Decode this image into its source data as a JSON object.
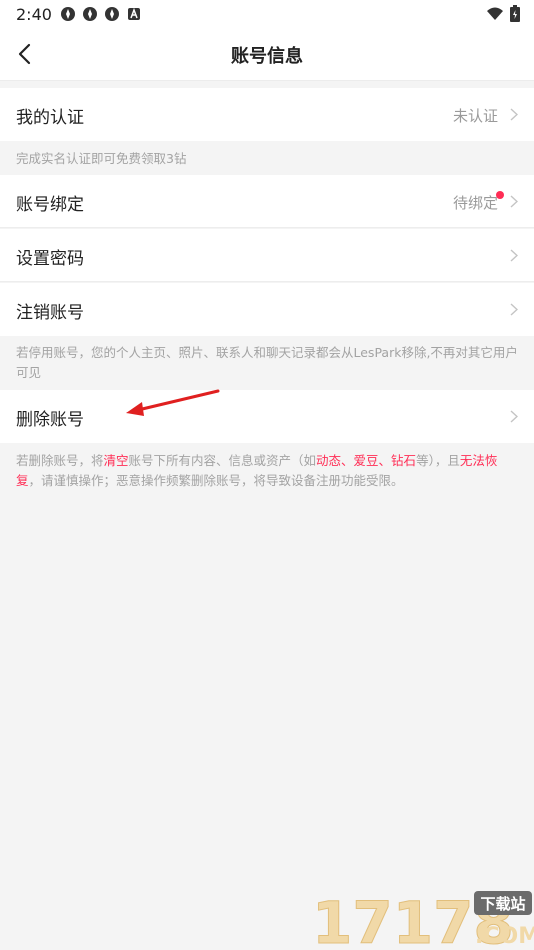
{
  "status_bar": {
    "time": "2:40"
  },
  "header": {
    "title": "账号信息"
  },
  "rows": {
    "certification": {
      "label": "我的认证",
      "value": "未认证"
    },
    "binding": {
      "label": "账号绑定",
      "value": "待绑定"
    },
    "password": {
      "label": "设置密码"
    },
    "cancel": {
      "label": "注销账号"
    },
    "delete": {
      "label": "删除账号"
    }
  },
  "notes": {
    "certification": "完成实名认证即可免费领取3钻",
    "cancel": "若停用账号，您的个人主页、照片、联系人和聊天记录都会从LesPark移除,不再对其它用户可见",
    "delete": {
      "p1": "若删除账号，将",
      "h1": "清空",
      "p2": "账号下所有内容、信息或资产（如",
      "h2": "动态、爱豆、钻石",
      "p3": "等），且",
      "h3": "无法恢复",
      "p4": "，请谨慎操作；恶意操作频繁删除账号，将导致设备注册功能受限。"
    }
  },
  "watermark": {
    "number": "17178",
    "badge": "下载站",
    "domain": ".COM"
  },
  "colors": {
    "accent": "#ff2d55",
    "background": "#f4f4f4",
    "arrow": "#e02020"
  }
}
